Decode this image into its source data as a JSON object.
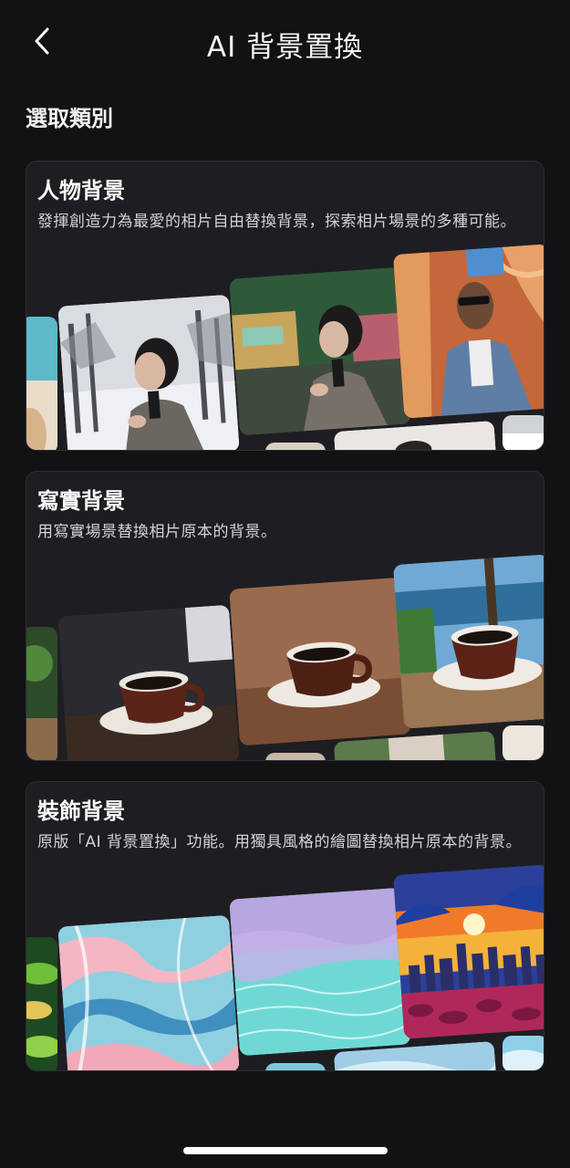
{
  "header": {
    "title": "AI 背景置換",
    "back_icon": "chevron-left-icon"
  },
  "section": {
    "heading": "選取類別"
  },
  "categories": [
    {
      "title": "人物背景",
      "description": "發揮創造力為最愛的相片自由替換背景，探索相片場景的多種可能。",
      "preview": "portrait-woman-snow-street-man-canyon"
    },
    {
      "title": "寫實背景",
      "description": "用寫實場景替換相片原本的背景。",
      "preview": "coffee-cup-wood-brown-seaside"
    },
    {
      "title": "裝飾背景",
      "description": "原版「AI 背景置換」功能。用獨具風格的繪圖替換相片原本的背景。",
      "preview": "marble-swirl-water-sunset-city"
    }
  ],
  "colors": {
    "background": "#121214",
    "card": "#1e1e22",
    "text_primary": "#ffffff",
    "text_secondary": "#d4d4d8"
  }
}
